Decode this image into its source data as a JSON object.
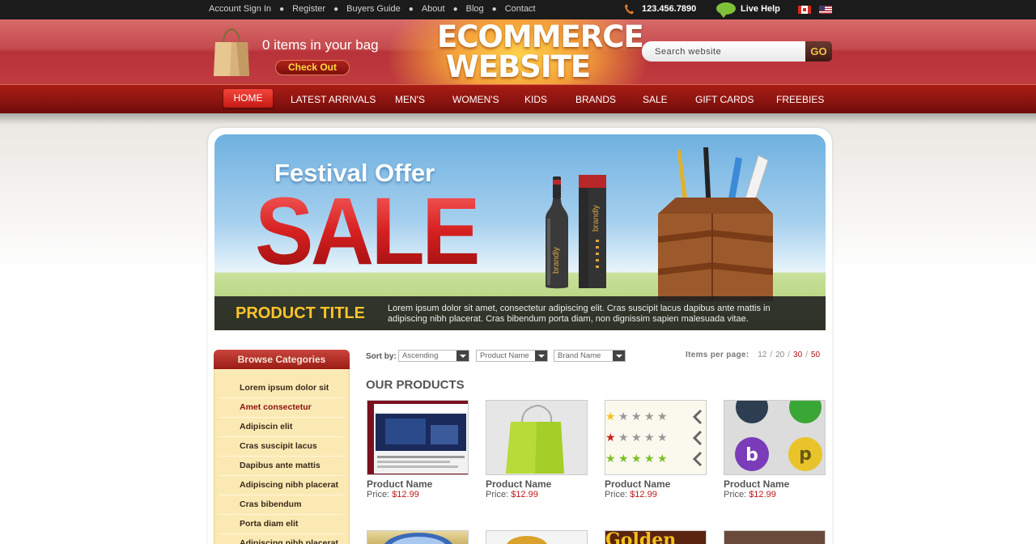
{
  "topbar": {
    "links": [
      "Account Sign In",
      "Register",
      "Buyers Guide",
      "About",
      "Blog",
      "Contact"
    ],
    "phone": "123.456.7890",
    "live_help": "Live Help",
    "flags": [
      "canada-flag-icon",
      "usa-flag-icon"
    ]
  },
  "header": {
    "bag_text": "0 items in your bag",
    "checkout_label": "Check Out",
    "logo_line1": "ECOMMERCE",
    "logo_line2": "WEBSITE",
    "search_placeholder": "Search website",
    "search_button": "GO"
  },
  "nav": {
    "items": [
      "HOME",
      "LATEST ARRIVALS",
      "MEN'S",
      "WOMEN'S",
      "KIDS",
      "BRANDS",
      "SALE",
      "GIFT CARDS",
      "FREEBIES"
    ],
    "active": "HOME"
  },
  "banner": {
    "headline": "Festival Offer",
    "big_text": "SALE",
    "bottle_label": "brandly",
    "product_title": "PRODUCT TITLE",
    "description": "Lorem ipsum dolor sit amet, consectetur adipiscing elit. Cras suscipit lacus dapibus ante mattis in adipiscing nibh placerat. Cras bibendum porta diam, non dignissim sapien malesuada vitae."
  },
  "sidebar": {
    "title": "Browse Categories",
    "categories": [
      "Lorem ipsum dolor sit",
      "Amet consectetur",
      "Adipiscin elit",
      "Cras suscipit lacus",
      "Dapibus ante mattis",
      "Adipiscing nibh placerat",
      "Cras bibendum",
      "Porta diam elit",
      "Adipiscing nibh placerat"
    ],
    "active_index": 1
  },
  "sort": {
    "label": "Sort by:",
    "order": "Ascending",
    "field": "Product Name",
    "brand": "Brand Name"
  },
  "items_per_page": {
    "label": "Items per page:",
    "options": [
      "12",
      "20",
      "30",
      "50"
    ],
    "highlighted": [
      "30",
      "50"
    ]
  },
  "products": {
    "heading": "OUR PRODUCTS",
    "items": [
      {
        "name": "Product Name",
        "price_label": "Price:",
        "price": "$12.99"
      },
      {
        "name": "Product Name",
        "price_label": "Price:",
        "price": "$12.99"
      },
      {
        "name": "Product Name",
        "price_label": "Price:",
        "price": "$12.99"
      },
      {
        "name": "Product Name",
        "price_label": "Price:",
        "price": "$12.99"
      }
    ],
    "row2_partial_text": [
      "Golden"
    ]
  },
  "colors": {
    "brand_red": "#b8323a",
    "nav_red": "#8c1410",
    "price_red": "#c01818",
    "title_gold": "#ffc42a"
  }
}
